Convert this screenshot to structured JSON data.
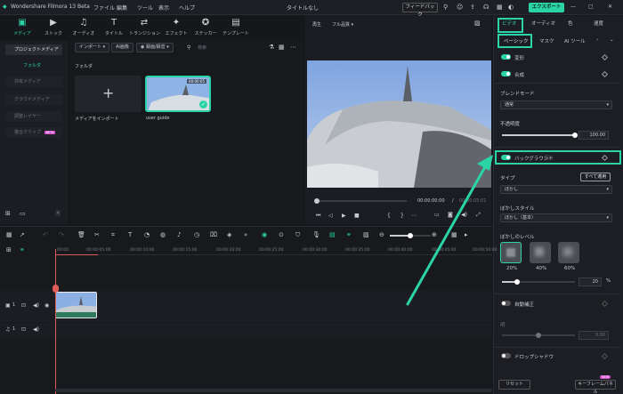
{
  "titlebar": {
    "app_name": "Wondershare Filmora 13 Beta",
    "menus": [
      "ファイル",
      "編集",
      "ツール",
      "表示",
      "ヘルプ"
    ],
    "doc_title": "タイトルなし",
    "feedback": "フィードバック",
    "export": "エクスポート"
  },
  "toolbar": {
    "tabs": [
      {
        "label": "メディア",
        "icon": "media-icon"
      },
      {
        "label": "ストック",
        "icon": "stock-icon"
      },
      {
        "label": "オーディオ",
        "icon": "music-icon"
      },
      {
        "label": "タイトル",
        "icon": "title-icon"
      },
      {
        "label": "トランジション",
        "icon": "transition-icon"
      },
      {
        "label": "エフェクト",
        "icon": "effect-icon"
      },
      {
        "label": "ステッカー",
        "icon": "sticker-icon"
      },
      {
        "label": "テンプレート",
        "icon": "template-icon"
      }
    ]
  },
  "leftnav": {
    "project_media": "プロジェクトメディア",
    "folder": "フォルダ",
    "items": [
      "共有メディア",
      "クラウドメディア",
      "調整レイヤー",
      "複合クリップ"
    ],
    "beta_badge": "BETA"
  },
  "media": {
    "import_btn": "インポート",
    "ai_image": "AI画像",
    "record": "録画/録音",
    "search_placeholder": "検索",
    "folder_label": "フォルダ",
    "import_tile_label": "メディアをインポート",
    "clip_name": "user guide",
    "clip_duration": "00:00:05"
  },
  "preview": {
    "play_label": "再生",
    "quality": "フル品質",
    "current_time": "00:00:00:00",
    "separator": "/",
    "total_time": "00:00:05:01"
  },
  "right": {
    "tabs": [
      "ビデオ",
      "オーディオ",
      "色",
      "速度"
    ],
    "subtabs": [
      "ベーシック",
      "マスク",
      "AI ツール"
    ],
    "transform": "変形",
    "composite": "合成",
    "blend_mode_label": "ブレンドモード",
    "blend_mode_value": "通常",
    "opacity_label": "不透明度",
    "opacity_value": "100.00",
    "background_label": "バックグラウンド",
    "type_label": "タイプ",
    "apply_all": "すべて適用",
    "type_value": "ぼかし",
    "blur_style_label": "ぼかしスタイル",
    "blur_style_value": "ぼかし（基本）",
    "blur_level_label": "ぼかしのレベル",
    "blur_levels": [
      "20%",
      "40%",
      "60%"
    ],
    "blur_value": "20",
    "blur_unit": "%",
    "auto_correct": "自動補正",
    "brightness_label": "明",
    "brightness_value": "0.00",
    "drop_shadow": "ドロップシャドウ",
    "reset": "リセット",
    "keyframe_panel": "キーフレームパネル",
    "new_badge": "NEW"
  },
  "timeline": {
    "ruler": [
      "00:00",
      "00:00:05:00",
      "00:00:10:00",
      "00:00:15:00",
      "00:00:20:00",
      "00:00:25:00",
      "00:00:30:00",
      "00:00:35:00",
      "00:00:40:00",
      "00:00:45:00",
      "00:00:50:00"
    ],
    "video_track": "1",
    "audio_track": "1"
  },
  "colors": {
    "accent": "#2ad4a6",
    "bg": "#15171b",
    "panel": "#1c1e23"
  }
}
